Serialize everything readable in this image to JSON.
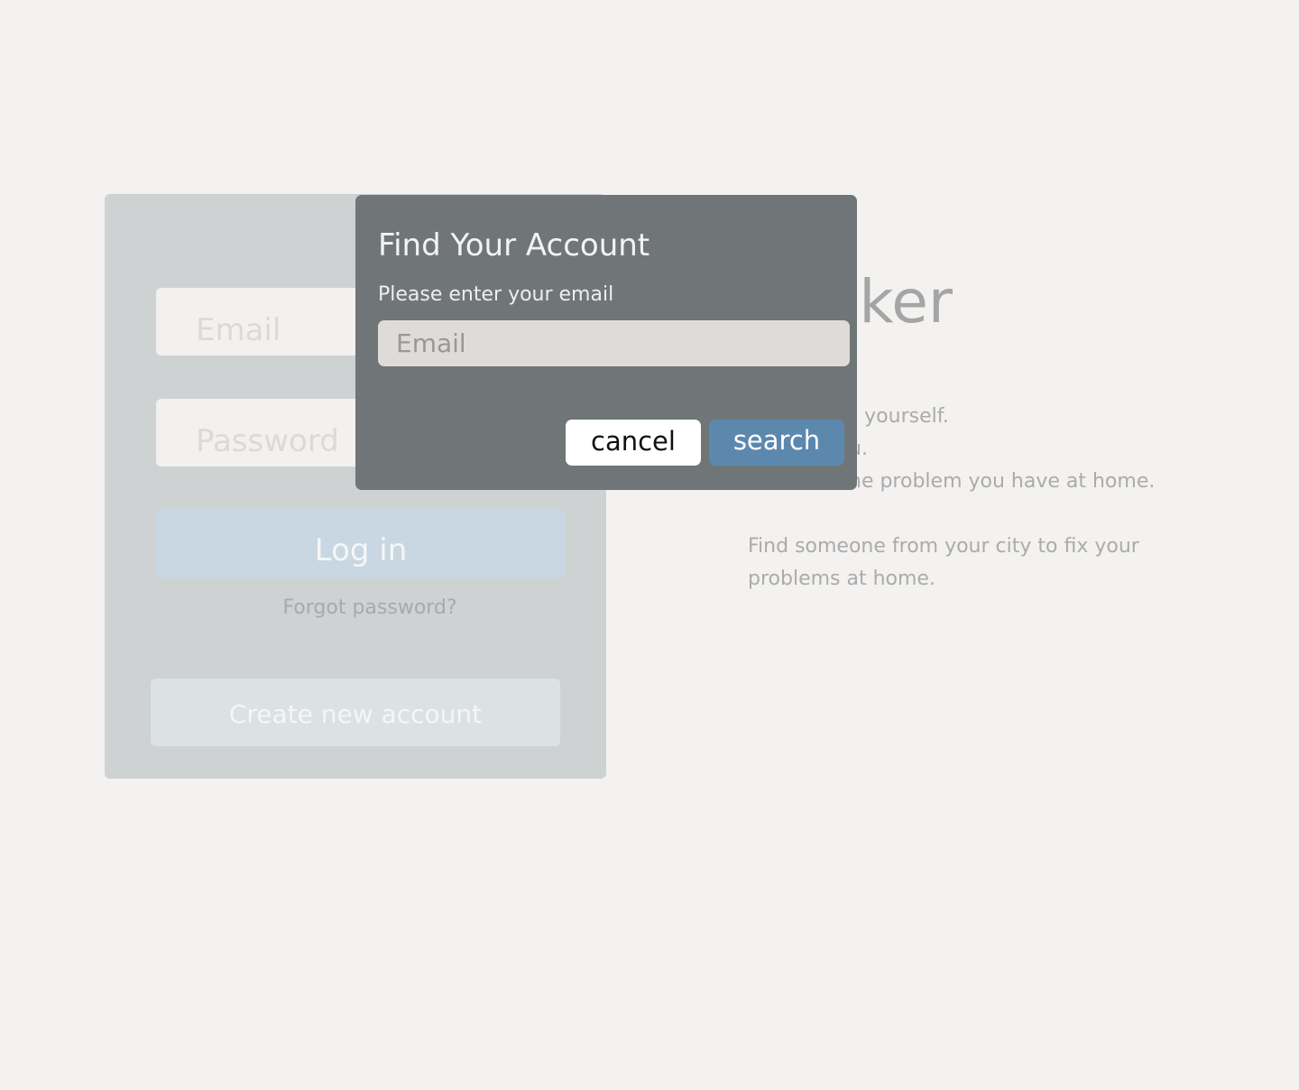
{
  "login": {
    "email_placeholder": "Email",
    "password_placeholder": "Password",
    "login_label": "Log in",
    "forgot_label": "Forgot password?",
    "create_label": "Create new account"
  },
  "info": {
    "brand_partial": "ker",
    "lines": [
      "te yourself.",
      "u.",
      "he problem you have at home."
    ],
    "tagline": "Find someone from your city to fix your problems at home."
  },
  "modal": {
    "title": "Find Your Account",
    "subtitle": "Please enter your email",
    "email_placeholder": "Email",
    "cancel_label": "cancel",
    "search_label": "search"
  },
  "colors": {
    "background": "#f3f2f0",
    "modal_background": "#707677",
    "search_button": "#5c88ae",
    "login_button": "#c8d7e1"
  }
}
